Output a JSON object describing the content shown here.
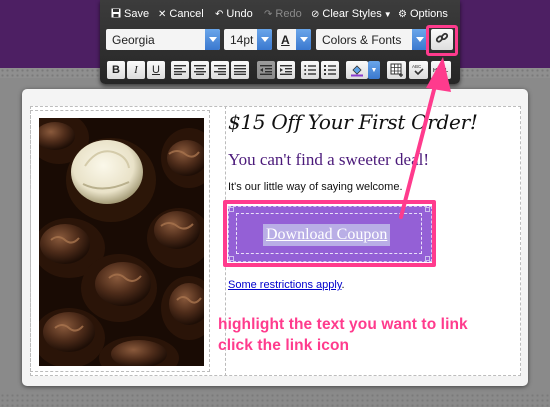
{
  "toolbar": {
    "save_label": "Save",
    "cancel_label": "Cancel",
    "undo_label": "Undo",
    "redo_label": "Redo",
    "clear_styles_label": "Clear Styles",
    "options_label": "Options",
    "font_family": "Georgia",
    "font_size": "14pt",
    "colors_fonts_label": "Colors & Fonts",
    "bold": "B",
    "italic": "I",
    "underline": "U"
  },
  "content": {
    "headline": "$15 Off Your First Order!",
    "subhead": "You can't find a sweeter deal!",
    "body": "It's our little way of saying welcome.",
    "coupon_button_label": "Download Coupon",
    "restrictions_link": "Some restrictions apply",
    "restrictions_suffix": "."
  },
  "annotation": {
    "line1": "highlight the text you want to link",
    "line2": "click the link icon"
  },
  "colors": {
    "header_purple": "#4d1f63",
    "highlight_pink": "#ff3b8d",
    "coupon_purple": "#9460d6",
    "subhead_purple": "#4b1a7a",
    "link_blue": "#0000cc"
  },
  "icons": [
    "save-icon",
    "cancel-icon",
    "undo-icon",
    "redo-icon",
    "clear-styles-icon",
    "options-gear-icon",
    "link-icon",
    "chain-icon"
  ]
}
